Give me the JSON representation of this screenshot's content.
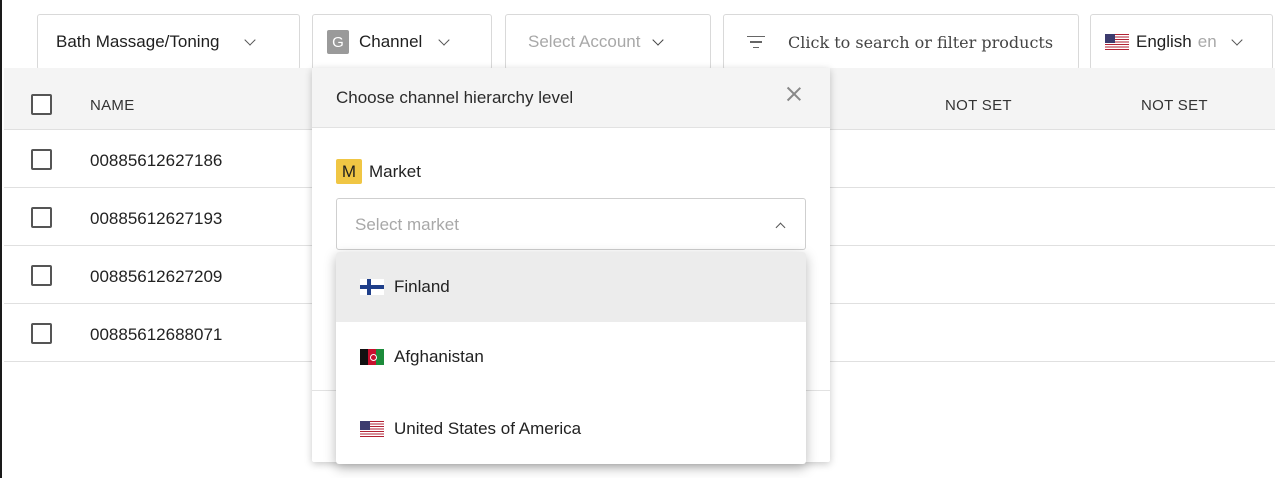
{
  "toolbar": {
    "category": {
      "label": "Bath Massage/Toning"
    },
    "channel": {
      "badge": "G",
      "label": "Channel"
    },
    "account": {
      "placeholder": "Select Account"
    },
    "search": {
      "placeholder": "Click to search or filter products"
    },
    "language": {
      "label": "English",
      "code": "en",
      "flag": "us-flag-icon"
    }
  },
  "table": {
    "columns": [
      "NAME",
      "NOT SET",
      "NOT SET"
    ],
    "rows": [
      {
        "name": "00885612627186"
      },
      {
        "name": "00885612627193"
      },
      {
        "name": "00885612627209"
      },
      {
        "name": "00885612688071"
      }
    ]
  },
  "channel_popover": {
    "title": "Choose channel hierarchy level",
    "level": {
      "badge": "M",
      "label": "Market"
    },
    "select": {
      "placeholder": "Select market"
    },
    "options": [
      {
        "label": "Finland",
        "flag": "finland-flag-icon",
        "highlighted": true
      },
      {
        "label": "Afghanistan",
        "flag": "afghanistan-flag-icon",
        "highlighted": false
      },
      {
        "label": "United States of America",
        "flag": "usa-flag-icon",
        "highlighted": false
      }
    ]
  },
  "colors": {
    "market_badge": "#f0c644",
    "channel_badge": "#9a9a9a",
    "header_bg": "#f4f4f4",
    "highlight_bg": "#ececec"
  }
}
